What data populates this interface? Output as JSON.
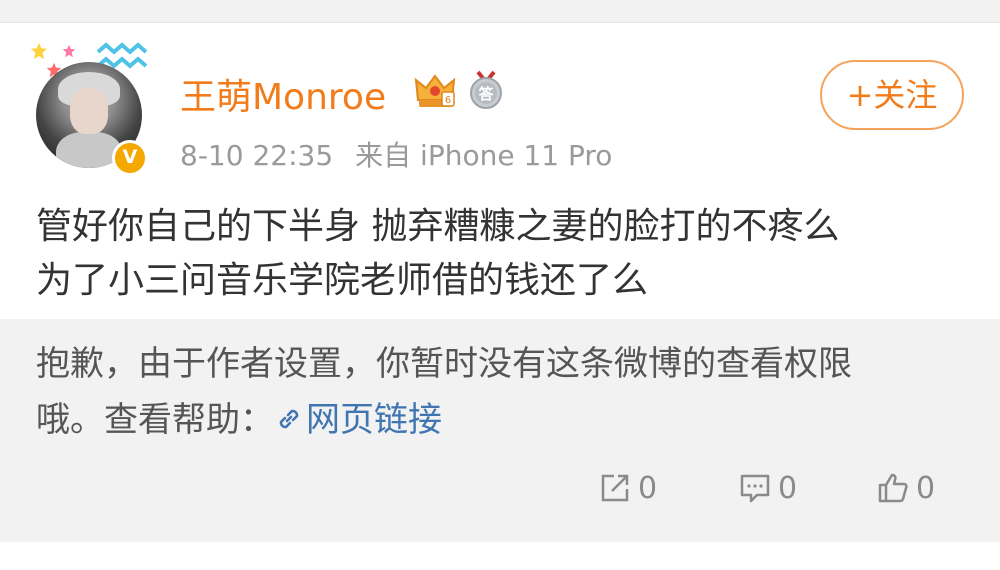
{
  "post": {
    "username": "王萌Monroe",
    "time": "8-10 22:35",
    "source": "来自 iPhone 11 Pro",
    "follow_label": "+关注",
    "text_line1": "管好你自己的下半身 抛弃糟糠之妻的脸打的不疼么",
    "text_line2": "为了小三问音乐学院老师借的钱还了么"
  },
  "notice": {
    "line1": "抱歉，由于作者设置，你暂时没有这条微博的查看权限",
    "line2_prefix": "哦。查看帮助：",
    "link_label": "网页链接"
  },
  "actions": {
    "repost_count": "0",
    "comment_count": "0",
    "like_count": "0"
  },
  "colors": {
    "username": "#f27c1a",
    "link": "#3f75b0",
    "verified_badge": "#f5a800"
  },
  "icons": {
    "avatar_badge": "verified-v-icon",
    "crown": "crown-icon",
    "medal": "answer-medal-icon",
    "link": "link-icon",
    "repost": "repost-icon",
    "comment": "comment-icon",
    "like": "thumbs-up-icon"
  }
}
